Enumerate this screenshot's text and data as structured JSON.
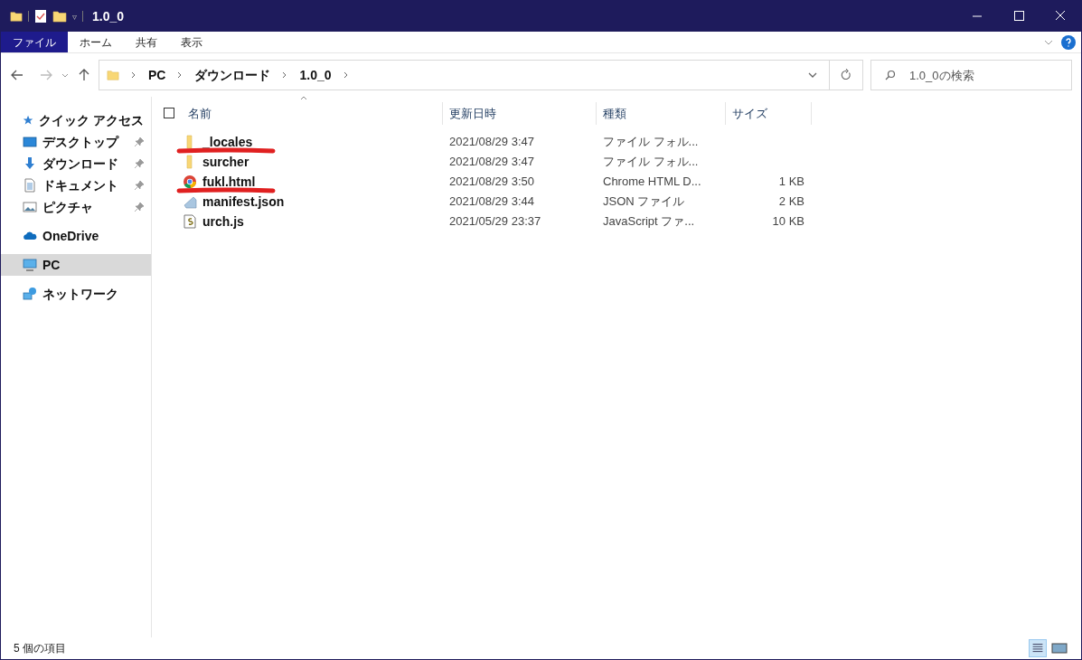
{
  "window": {
    "title": "1.0_0",
    "quick_access_toolbar": {
      "dropdown_glyph": "▿"
    }
  },
  "ribbon": {
    "tabs": [
      {
        "label": "ファイル",
        "selected": true
      },
      {
        "label": "ホーム",
        "selected": false
      },
      {
        "label": "共有",
        "selected": false
      },
      {
        "label": "表示",
        "selected": false
      }
    ]
  },
  "address_bar": {
    "crumbs": [
      "PC",
      "ダウンロード",
      "1.0_0"
    ]
  },
  "search": {
    "placeholder": "1.0_0の検索"
  },
  "sidebar": {
    "items": [
      {
        "label": "クイック アクセス",
        "kind": "star",
        "pinned": false,
        "selected": false,
        "children": [
          {
            "label": "デスクトップ",
            "kind": "desktop",
            "pinned": true,
            "selected": false
          },
          {
            "label": "ダウンロード",
            "kind": "download",
            "pinned": true,
            "selected": false
          },
          {
            "label": "ドキュメント",
            "kind": "document",
            "pinned": true,
            "selected": false
          },
          {
            "label": "ピクチャ",
            "kind": "picture",
            "pinned": true,
            "selected": false
          }
        ]
      },
      {
        "label": "OneDrive",
        "kind": "cloud",
        "pinned": false,
        "selected": false
      },
      {
        "label": "PC",
        "kind": "pc",
        "pinned": false,
        "selected": true
      },
      {
        "label": "ネットワーク",
        "kind": "network",
        "pinned": false,
        "selected": false
      }
    ]
  },
  "table": {
    "select_all": {
      "checked": false
    },
    "columns": [
      "名前",
      "更新日時",
      "種類",
      "サイズ"
    ],
    "rows": [
      {
        "kind": "folder",
        "name": "_locales",
        "date": "2021/08/29 3:47",
        "type": "ファイル フォル...",
        "size": "",
        "underlined": true
      },
      {
        "kind": "folder",
        "name": "surcher",
        "date": "2021/08/29 3:47",
        "type": "ファイル フォル...",
        "size": "",
        "underlined": false
      },
      {
        "kind": "chrome",
        "name": "fukl.html",
        "date": "2021/08/29 3:50",
        "type": "Chrome HTML D...",
        "size": "1 KB",
        "underlined": true
      },
      {
        "kind": "json",
        "name": "manifest.json",
        "date": "2021/08/29 3:44",
        "type": "JSON ファイル",
        "size": "2 KB",
        "underlined": false
      },
      {
        "kind": "script",
        "name": "urch.js",
        "date": "2021/05/29 23:37",
        "type": "JavaScript ファ...",
        "size": "10 KB",
        "underlined": false
      }
    ]
  },
  "status_bar": {
    "text": "5 個の項目"
  }
}
